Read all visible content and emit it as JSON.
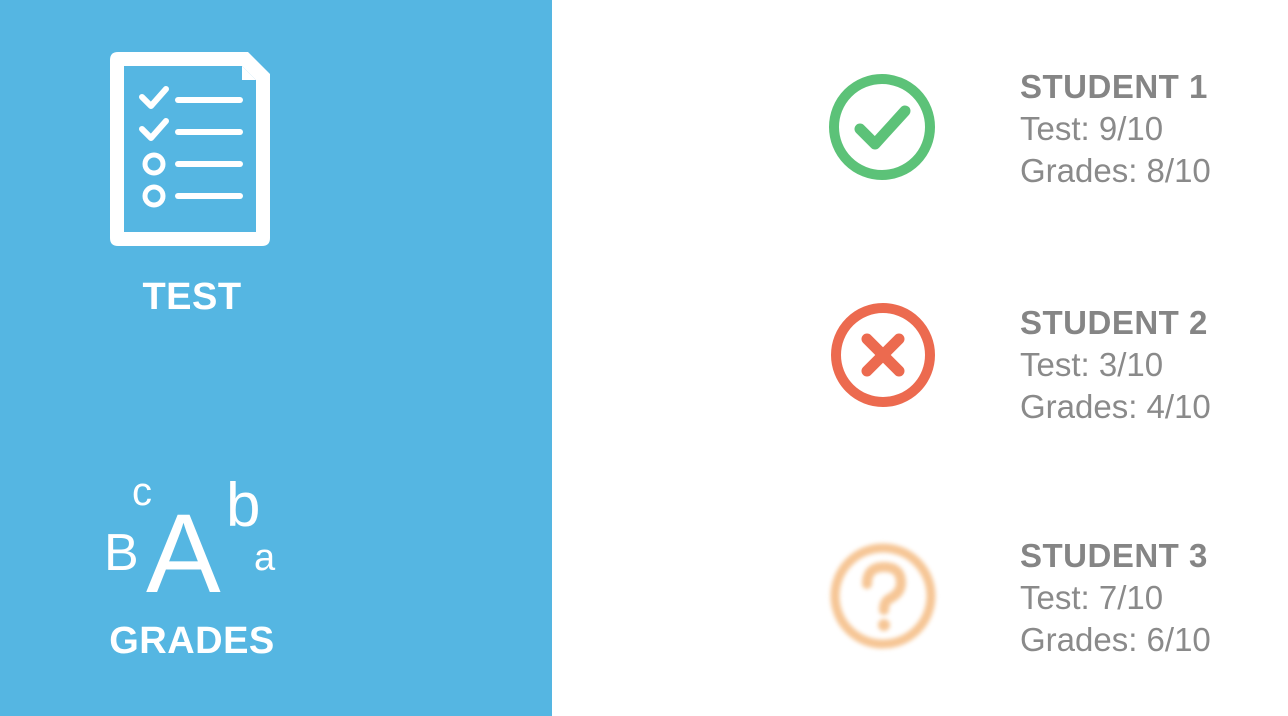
{
  "left_panel": {
    "test_label": "TEST",
    "grades_label": "GRADES",
    "grades_icon_letters": {
      "c": "c",
      "b_upper": "B",
      "a_upper": "A",
      "b_lower": "b",
      "a_lower": "a"
    }
  },
  "students": [
    {
      "name": "STUDENT 1",
      "test": "Test: 9/10",
      "grades": "Grades: 8/10",
      "status_icon": "check-circle-icon",
      "color": "#5cc278"
    },
    {
      "name": "STUDENT 2",
      "test": "Test: 3/10",
      "grades": "Grades: 4/10",
      "status_icon": "x-circle-icon",
      "color": "#ec6a4f"
    },
    {
      "name": "STUDENT 3",
      "test": "Test: 7/10",
      "grades": "Grades: 6/10",
      "status_icon": "question-circle-icon",
      "color": "#f7c48e"
    }
  ],
  "colors": {
    "panel": "#55b6e2",
    "text": "#8a8a8a"
  }
}
